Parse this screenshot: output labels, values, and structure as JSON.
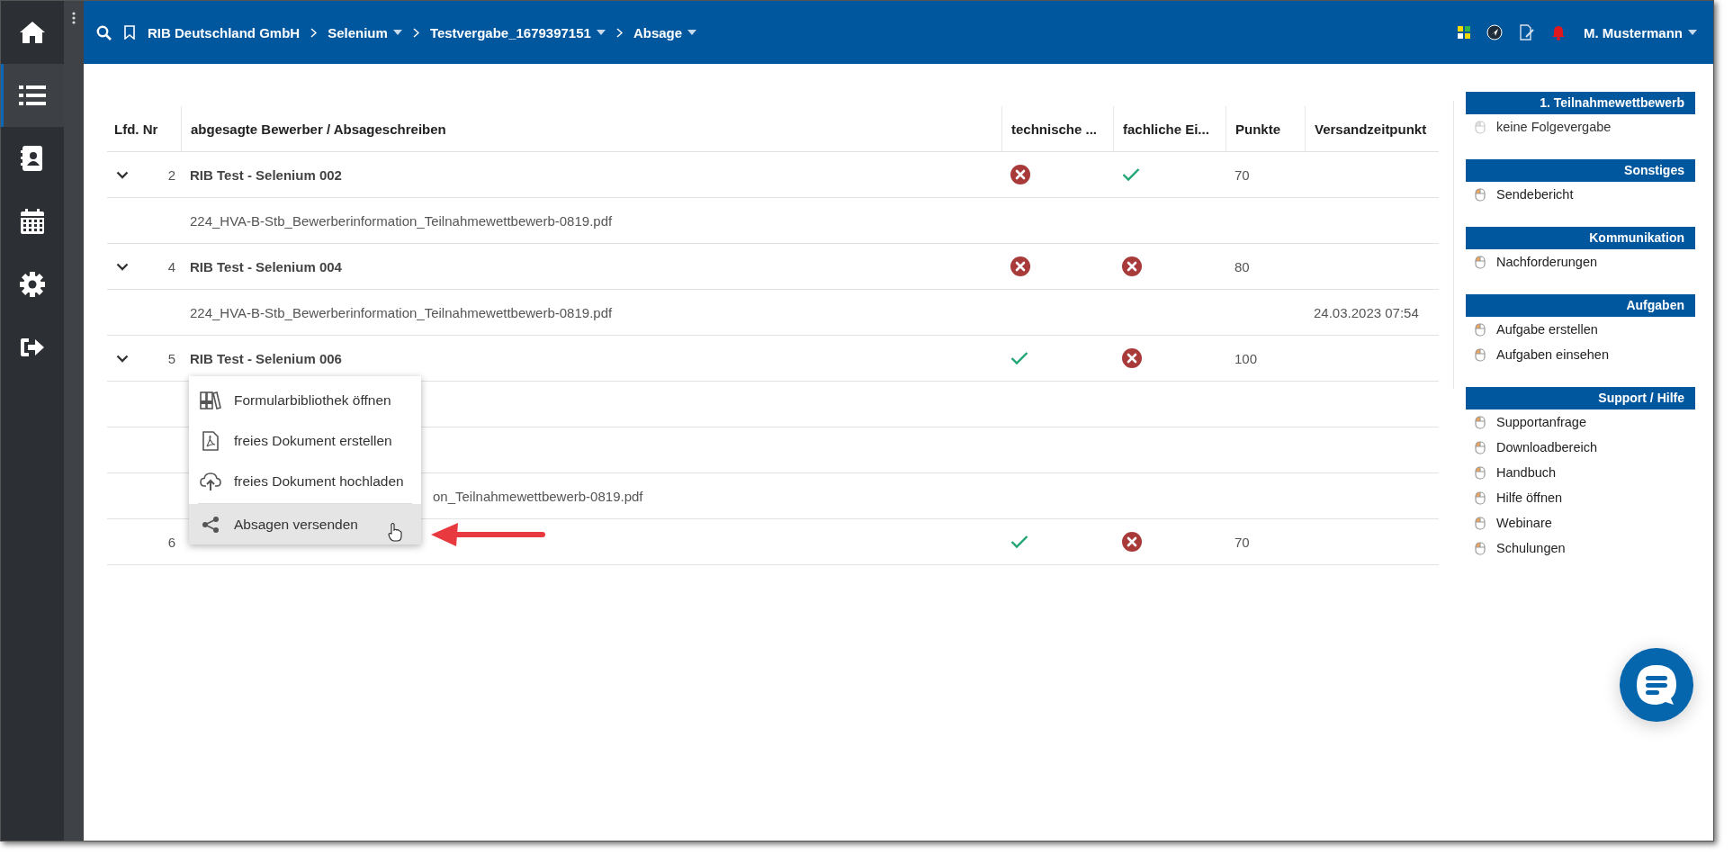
{
  "sidebar": {
    "items": [
      {
        "selected": false
      },
      {
        "selected": true
      },
      {
        "selected": false
      },
      {
        "selected": false
      },
      {
        "selected": false
      },
      {
        "selected": false
      }
    ]
  },
  "breadcrumb": [
    {
      "label": "RIB Deutschland GmbH",
      "dropdown": false
    },
    {
      "label": "Selenium",
      "dropdown": true
    },
    {
      "label": "Testvergabe_1679397151",
      "dropdown": true
    },
    {
      "label": "Absage",
      "dropdown": true
    }
  ],
  "user": {
    "name": "M. Mustermann"
  },
  "table": {
    "columns": [
      "Lfd. Nr",
      "abgesagte Bewerber / Absageschreiben",
      "technische ...",
      "fachliche Ei...",
      "Punkte",
      "Versandzeitpunkt"
    ],
    "rows": [
      {
        "kind": "group",
        "expanded": true,
        "number": "2",
        "name": "RIB Test - Selenium 002",
        "technical_passed": false,
        "professional_passed": true,
        "points": "70",
        "children": [
          {
            "kind": "file",
            "file": "224_HVA-B-Stb_Bewerberinformation_Teilnahmewettbewerb-0819.pdf"
          }
        ]
      },
      {
        "kind": "group",
        "expanded": true,
        "number": "4",
        "name": "RIB Test - Selenium 004",
        "technical_passed": false,
        "professional_passed": false,
        "points": "80",
        "children": [
          {
            "kind": "file",
            "file": "224_HVA-B-Stb_Bewerberinformation_Teilnahmewettbewerb-0819.pdf",
            "sent": "24.03.2023 07:54"
          }
        ]
      },
      {
        "kind": "group",
        "expanded": true,
        "number": "5",
        "name": "RIB Test - Selenium 006",
        "technical_passed": true,
        "professional_passed": false,
        "points": "100",
        "children": [
          {
            "kind": "covered"
          },
          {
            "kind": "covered"
          },
          {
            "kind": "partial",
            "file": "on_Teilnahmewettbewerb-0819.pdf"
          }
        ]
      },
      {
        "kind": "group",
        "number": "6",
        "technical_passed": true,
        "professional_passed": false,
        "points": "70"
      }
    ]
  },
  "context_menu": {
    "items": [
      {
        "label": "Formularbibliothek öffnen",
        "highlighted": false
      },
      {
        "label": "freies Dokument erstellen",
        "highlighted": false
      },
      {
        "label": "freies Dokument hochladen",
        "highlighted": false
      },
      {
        "label": "Absagen versenden",
        "highlighted": true
      }
    ]
  },
  "right_panel": {
    "sections": [
      {
        "title": "1. Teilnahmewettbewerb",
        "items": [
          {
            "label": "keine Folgevergabe",
            "disabled": true
          }
        ]
      },
      {
        "title": "Sonstiges",
        "items": [
          {
            "label": "Sendebericht",
            "disabled": false
          }
        ]
      },
      {
        "title": "Kommunikation",
        "items": [
          {
            "label": "Nachforderungen",
            "disabled": false
          }
        ]
      },
      {
        "title": "Aufgaben",
        "items": [
          {
            "label": "Aufgabe erstellen",
            "disabled": false
          },
          {
            "label": "Aufgaben einsehen",
            "disabled": false
          }
        ]
      },
      {
        "title": "Support / Hilfe",
        "items": [
          {
            "label": "Supportanfrage",
            "disabled": false
          },
          {
            "label": "Downloadbereich",
            "disabled": false
          },
          {
            "label": "Handbuch",
            "disabled": false
          },
          {
            "label": "Hilfe öffnen",
            "disabled": false
          },
          {
            "label": "Webinare",
            "disabled": false
          },
          {
            "label": "Schulungen",
            "disabled": false
          }
        ]
      }
    ]
  }
}
